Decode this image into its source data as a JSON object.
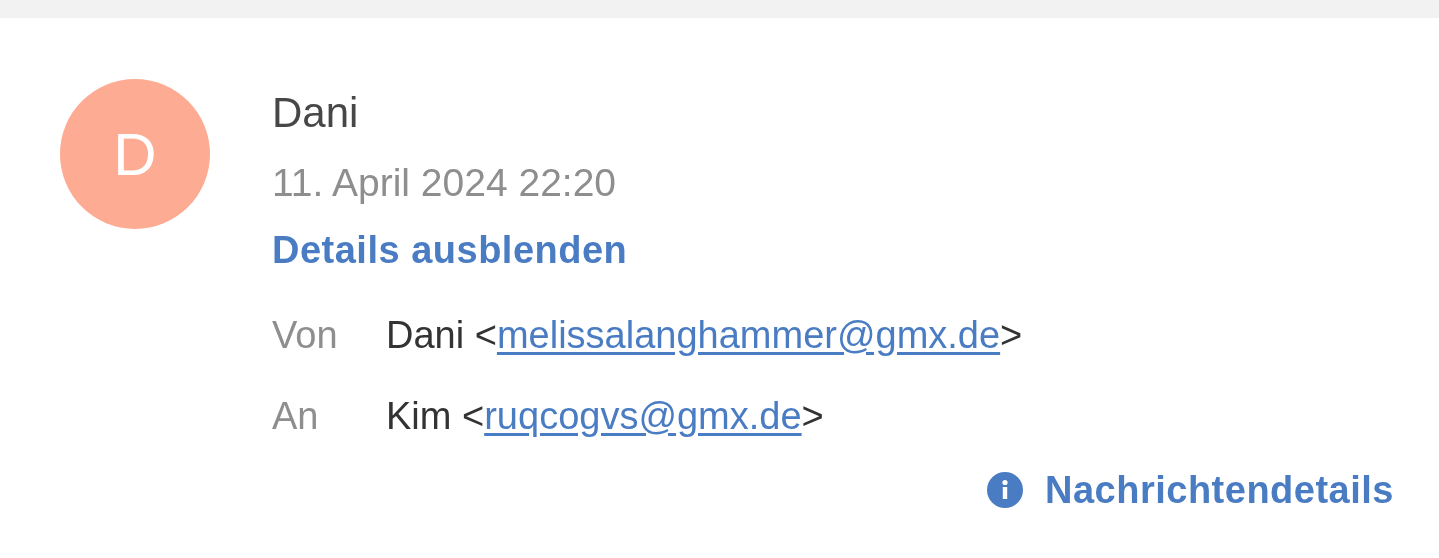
{
  "avatar": {
    "letter": "D",
    "color": "#fdab92"
  },
  "sender": {
    "name": "Dani",
    "date": "11. April 2024 22:20"
  },
  "details_toggle": "Details ausblenden",
  "fields": [
    {
      "label": "Von",
      "before": "Dani <",
      "email": "melissalanghammer@gmx.de",
      "after": ">"
    },
    {
      "label": "An",
      "before": "Kim <",
      "email": "ruqcogvs@gmx.de",
      "after": ">"
    }
  ],
  "message_details_link": "Nachrichtendetails"
}
